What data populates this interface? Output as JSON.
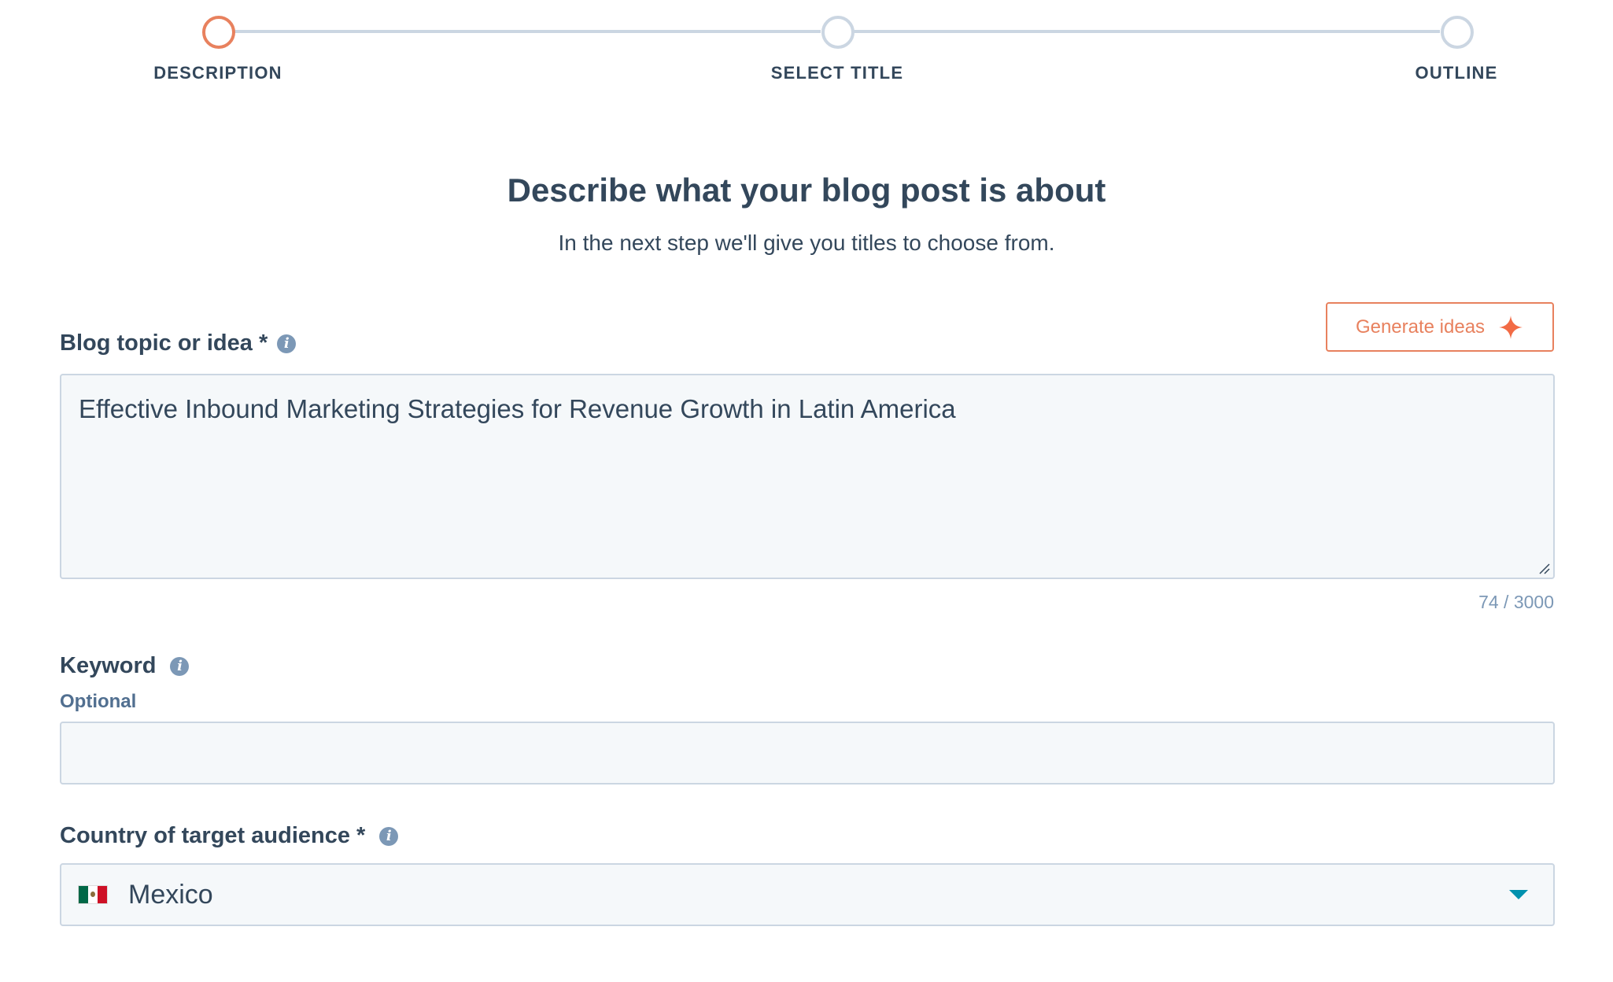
{
  "stepper": {
    "steps": [
      {
        "label": "DESCRIPTION",
        "state": "active"
      },
      {
        "label": "SELECT TITLE",
        "state": "inactive"
      },
      {
        "label": "OUTLINE",
        "state": "inactive"
      }
    ],
    "active_color": "#e8815e",
    "inactive_color": "#cbd6e2"
  },
  "header": {
    "title": "Describe what your blog post is about",
    "subtitle": "In the next step we'll give you titles to choose from."
  },
  "generate_button": {
    "label": "Generate ideas",
    "icon": "sparkle-icon",
    "color": "#e8815e"
  },
  "topic_field": {
    "label": "Blog topic or idea *",
    "value": "Effective Inbound Marketing Strategies for Revenue Growth in Latin America",
    "char_count": "74 / 3000"
  },
  "keyword_field": {
    "label": "Keyword",
    "optional_label": "Optional",
    "value": "",
    "placeholder": ""
  },
  "country_field": {
    "label": "Country of target audience *",
    "selected": "Mexico",
    "flag_icon": "mexico-flag-icon",
    "caret_color": "#0091ae"
  }
}
